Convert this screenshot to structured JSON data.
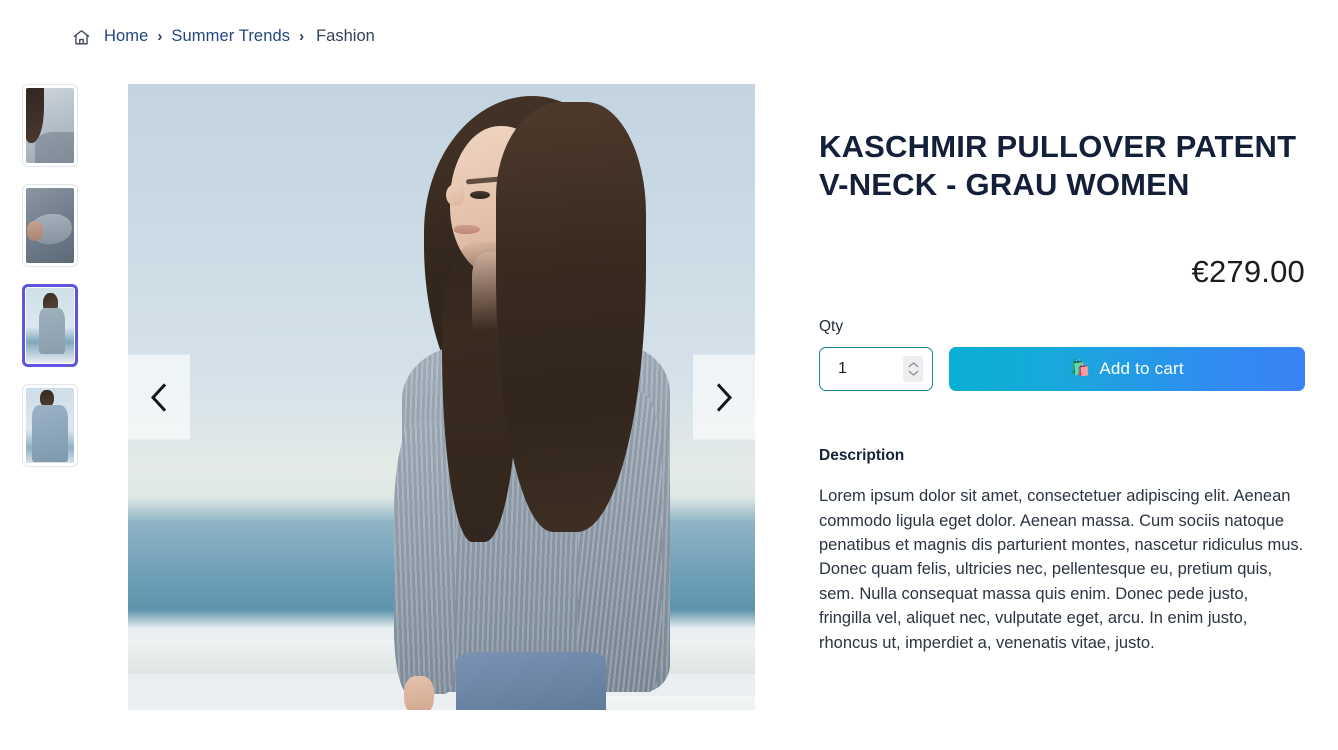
{
  "breadcrumb": {
    "home_icon": "home-icon",
    "separator": "›",
    "items": [
      {
        "label": "Home",
        "current": false
      },
      {
        "label": "Summer Trends",
        "current": false
      },
      {
        "label": "Fashion",
        "current": true
      }
    ]
  },
  "gallery": {
    "selected_index": 3,
    "thumbnails": [
      {
        "alt": "Close-up of grey cashmere v-neck neckline",
        "selected": false
      },
      {
        "alt": "Close-up of ribbed sleeve cuff on arm",
        "selected": false
      },
      {
        "alt": "Model wearing grey cashmere v-neck pullover by the sea",
        "selected": true
      },
      {
        "alt": "Model wearing grey pullover with light scarf",
        "selected": false
      }
    ],
    "main_image_alt": "Woman in grey cashmere v-neck pullover standing outdoors by the ocean",
    "prev_label": "Previous image",
    "next_label": "Next image",
    "prev_icon": "chevron-left-icon",
    "next_icon": "chevron-right-icon"
  },
  "product": {
    "title": "Kaschmir Pullover Patent V-Neck - Grau Women",
    "price": "€279.00",
    "currency_symbol": "€",
    "price_amount": "279.00",
    "qty_label": "Qty",
    "qty_value": "1",
    "qty_placeholder": "1",
    "add_to_cart_label": "Add to cart",
    "add_to_cart_icon": "🛍️",
    "description_heading": "Description",
    "description_text": "Lorem ipsum dolor sit amet, consectetuer adipiscing elit. Aenean commodo ligula eget dolor. Aenean massa. Cum sociis natoque penatibus et magnis dis parturient montes, nascetur ridiculus mus. Donec quam felis, ultricies nec, pellentesque eu, pretium quis, sem. Nulla consequat massa quis enim. Donec pede justo, fringilla vel, aliquet nec, vulputate eget, arcu. In enim justo, rhoncus ut, imperdiet a, venenatis vitae, justo."
  },
  "colors": {
    "page_background": "#ffffff",
    "title_text": "#14203a",
    "breadcrumb_link": "#22467e",
    "breadcrumb_current": "#33435c",
    "thumb_selected_border": "#5b55e0",
    "thumb_border": "#e2e5ea",
    "qty_border": "#17859b",
    "cart_gradient_start": "#0aafd3",
    "cart_gradient_end": "#3b82f6",
    "cart_text": "#ffffff",
    "body_text": "#2b3442"
  }
}
